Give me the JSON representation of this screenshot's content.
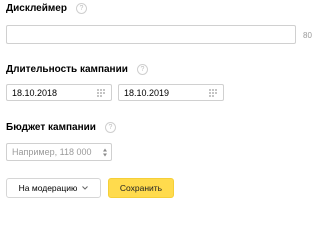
{
  "disclaimer": {
    "title": "Дисклеймер",
    "help": "?",
    "value": "",
    "counter": "80"
  },
  "duration": {
    "title": "Длительность кампании",
    "help": "?",
    "start_date": "18.10.2018",
    "end_date": "18.10.2019"
  },
  "budget": {
    "title": "Бюджет кампании",
    "help": "?",
    "placeholder": "Например, 118 000"
  },
  "actions": {
    "moderation_label": "На модерацию",
    "save_label": "Сохранить"
  },
  "colors": {
    "primary_button": "#ffdb4d",
    "border": "#d0d0d0",
    "muted_text": "#9a9a9a"
  },
  "icons": [
    "help-icon",
    "calendar-icon",
    "spin-arrows-icon",
    "chevron-down-icon"
  ]
}
